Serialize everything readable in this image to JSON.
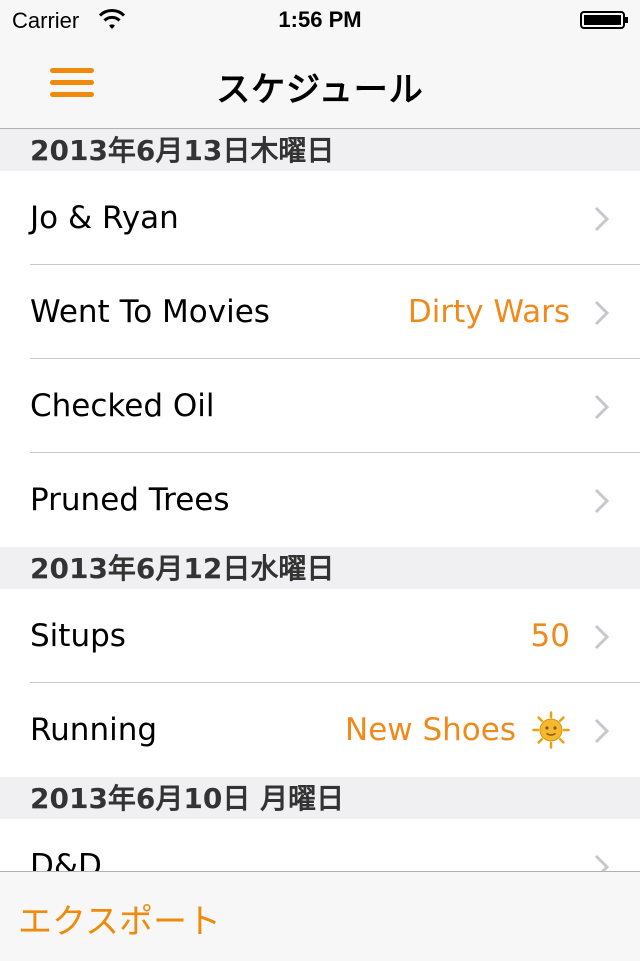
{
  "status_bar": {
    "carrier": "Carrier",
    "time": "1:56 PM"
  },
  "nav": {
    "title": "スケジュール",
    "menu_icon": "hamburger-menu-icon"
  },
  "sections": [
    {
      "header": "2013年6月13日木曜日",
      "rows": [
        {
          "label": "Jo & Ryan",
          "detail": ""
        },
        {
          "label": "Went To Movies",
          "detail": "Dirty Wars"
        },
        {
          "label": "Checked Oil",
          "detail": ""
        },
        {
          "label": "Pruned Trees",
          "detail": ""
        }
      ]
    },
    {
      "header": "2013年6月12日水曜日",
      "rows": [
        {
          "label": "Situps",
          "detail": "50"
        },
        {
          "label": "Running",
          "detail": "New Shoes",
          "icon": "sun-face-icon"
        }
      ]
    },
    {
      "header": "2013年6月10日 月曜日",
      "rows": [
        {
          "label": "D&D",
          "detail": ""
        }
      ]
    }
  ],
  "toolbar": {
    "export_label": "エクスポート"
  },
  "colors": {
    "accent": "#f08a0a",
    "detail_text": "#ef8b1d",
    "section_bg": "#f0f0f2",
    "bar_bg": "#f7f7f7"
  }
}
